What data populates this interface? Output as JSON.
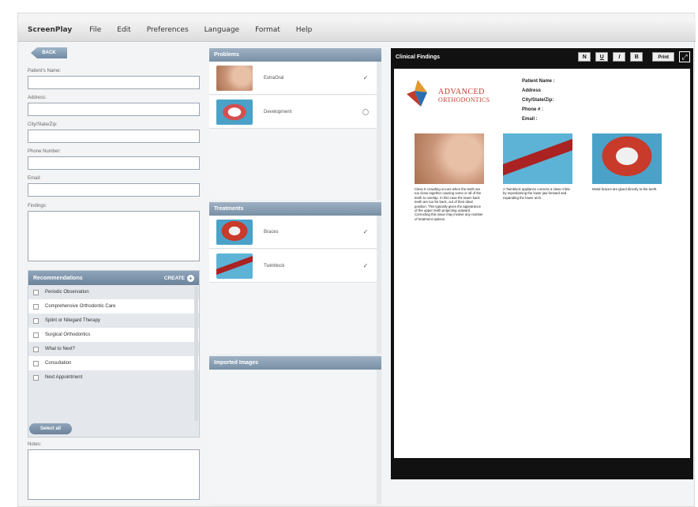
{
  "menubar": {
    "items": [
      "ScreenPlay",
      "File",
      "Edit",
      "Preferences",
      "Language",
      "Format",
      "Help"
    ]
  },
  "left": {
    "back_label": "BACK",
    "fields": [
      {
        "label": "Patient's Name:"
      },
      {
        "label": "Address:"
      },
      {
        "label": "City/State/Zip:"
      },
      {
        "label": "Phone Number:"
      },
      {
        "label": "Email:"
      },
      {
        "label": "Findings:"
      }
    ],
    "recommendations": {
      "title": "Recommendations",
      "create_label": "CREATE",
      "items": [
        "Periodic Observation",
        "Comprehensive Orthodontic Care",
        "Splint or Nitegard Therapy",
        "Surgical Orthodontics",
        "What to Next?",
        "Consultation",
        "Next Appointment"
      ],
      "select_all_label": "Select all"
    },
    "notes_label": "Notes:"
  },
  "middle": {
    "problems": {
      "title": "Problems",
      "items": [
        {
          "label": "ExtraOral",
          "checked": true,
          "icon": "face-profile-thumb"
        },
        {
          "label": "Development",
          "checked": false,
          "icon": "teeth-model-thumb"
        }
      ]
    },
    "treatments": {
      "title": "Treatments",
      "items": [
        {
          "label": "Braces",
          "checked": true,
          "icon": "braces-thumb"
        },
        {
          "label": "Twinblock",
          "checked": true,
          "icon": "twinblock-thumb"
        }
      ]
    },
    "imported": {
      "title": "Imported Images"
    }
  },
  "report": {
    "title": "Clinical Findings",
    "buttons": {
      "n": "N",
      "u": "U",
      "i": "I",
      "b": "B",
      "print": "Print"
    },
    "logo": {
      "line1": "ADVANCED",
      "line2": "ORTHODONTICS"
    },
    "patient_fields": [
      "Patient Name :",
      "Address",
      "City/State/Zip:",
      "Phone # :",
      "Email :"
    ],
    "findings": [
      {
        "caption": "Class II crowding occurs when the teeth are too close together causing some or all of the teeth to overlap. In this case the lower back teeth are too far back, out of their ideal position. This typically gives the appearance of the upper teeth projecting outward. Correcting this issue may involve any number of treatment options."
      },
      {
        "caption": "A Twinblock appliance corrects a class II bite by repositioning the lower jaw forward and expanding the lower arch."
      },
      {
        "caption": "Metal braces are glued directly to the teeth."
      }
    ]
  },
  "colors": {
    "panel_header": "#7890a6",
    "report_bar": "#111111",
    "logo_red": "#c23a2a"
  }
}
